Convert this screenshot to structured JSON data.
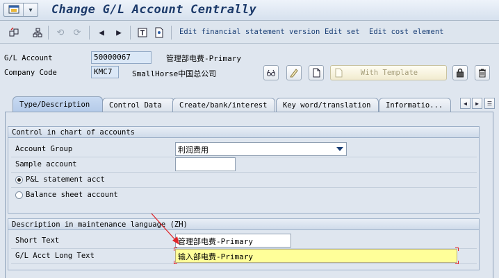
{
  "window": {
    "title": "Change G/L Account Centrally"
  },
  "toolbar": {
    "links": [
      "Edit financial statement version",
      "Edit set",
      "Edit cost element"
    ]
  },
  "header": {
    "gl_account_label": "G/L Account",
    "gl_account_value": "50000067",
    "gl_account_desc": "管理部电费-Primary",
    "company_code_label": "Company Code",
    "company_code_value": "KMC7",
    "company_code_desc": "SmallHorse中国总公司",
    "template_button_label": "With Template"
  },
  "tabs": [
    "Type/Description",
    "Control Data",
    "Create/bank/interest",
    "Key word/translation",
    "Informatio..."
  ],
  "control_group": {
    "title": "Control in chart of accounts",
    "account_group_label": "Account Group",
    "account_group_value": "利润费用",
    "sample_account_label": "Sample account",
    "sample_account_value": "",
    "pl_radio_label": "P&L statement acct",
    "bs_radio_label": "Balance sheet account",
    "selected": "pl"
  },
  "description_group": {
    "title": "Description in maintenance language (ZH)",
    "short_text_label": "Short Text",
    "short_text_value": "管理部电费-Primary",
    "long_text_label": "G/L Acct Long Text",
    "long_text_value": "输入部电费-Primary"
  },
  "colors": {
    "accent": "#1a3f76",
    "highlight": "#ffff99",
    "annotation": "#e0262a"
  }
}
